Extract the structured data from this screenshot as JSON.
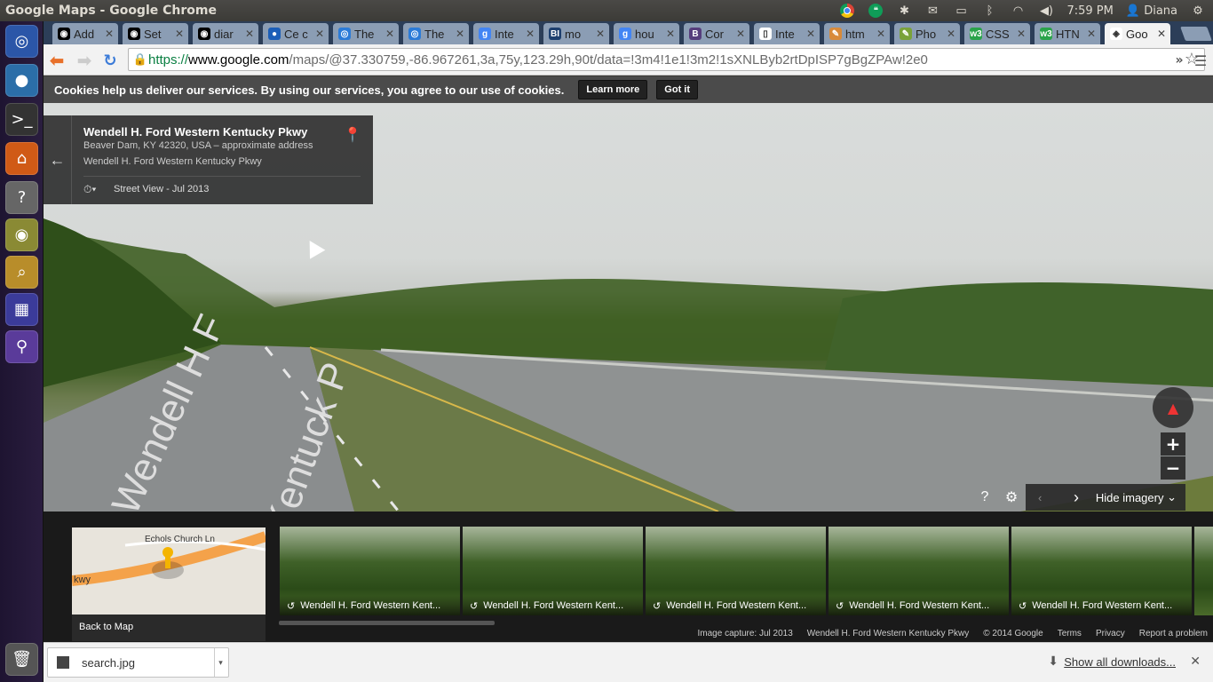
{
  "window_title": "Google Maps - Google Chrome",
  "panel": {
    "time": "7:59 PM",
    "user": "Diana"
  },
  "launcher": {
    "items": [
      {
        "name": "dash-icon",
        "color": "#2b56a8",
        "glyph": "◎"
      },
      {
        "name": "chrome-icon",
        "color": "#2b6ea8",
        "glyph": "●"
      },
      {
        "name": "terminal-icon",
        "color": "#333333",
        "glyph": ">_"
      },
      {
        "name": "files-icon",
        "color": "#d05a16",
        "glyph": "⌂"
      },
      {
        "name": "help-icon",
        "color": "#666666",
        "glyph": "?"
      },
      {
        "name": "speaker-icon",
        "color": "#8a8a34",
        "glyph": "◉"
      },
      {
        "name": "search-tool-icon",
        "color": "#b88d2a",
        "glyph": "⌕"
      },
      {
        "name": "workspace-icon",
        "color": "#3b3b9a",
        "glyph": "▦"
      },
      {
        "name": "usb-icon",
        "color": "#5a3b9a",
        "glyph": "⚲"
      }
    ],
    "trash": "trash-icon"
  },
  "tabs": [
    {
      "label": "Add",
      "fav": "#000000",
      "glyph": "◉"
    },
    {
      "label": "Set",
      "fav": "#000000",
      "glyph": "◉"
    },
    {
      "label": "diar",
      "fav": "#000000",
      "glyph": "◉"
    },
    {
      "label": "Ce c",
      "fav": "#1b5eb8",
      "glyph": "●"
    },
    {
      "label": "The",
      "fav": "#2b7bd8",
      "glyph": "◎"
    },
    {
      "label": "The",
      "fav": "#2b7bd8",
      "glyph": "◎"
    },
    {
      "label": "Inte",
      "fav": "#4285f4",
      "glyph": "g"
    },
    {
      "label": "mo",
      "fav": "#1d3f6e",
      "glyph": "BI"
    },
    {
      "label": "hou",
      "fav": "#4285f4",
      "glyph": "g"
    },
    {
      "label": "Cor",
      "fav": "#563d7c",
      "glyph": "B"
    },
    {
      "label": "Inte",
      "fav": "#ffffff",
      "glyph": "▯"
    },
    {
      "label": "htm",
      "fav": "#d88a3a",
      "glyph": "✎"
    },
    {
      "label": "Pho",
      "fav": "#7aa23a",
      "glyph": "✎"
    },
    {
      "label": "CSS",
      "fav": "#2aa34a",
      "glyph": "w3"
    },
    {
      "label": "HTN",
      "fav": "#2aa34a",
      "glyph": "w3"
    },
    {
      "label": "Goo",
      "fav": "#ffffff",
      "glyph": "◈",
      "active": true
    }
  ],
  "url": {
    "scheme": "https://",
    "domain": "www.google.com",
    "path": "/maps/@37.330759,-86.967261,3a,75y,123.29h,90t/data=!3m4!1e1!3m2!1sXNLByb2rtDpISP7gBgZPAw!2e0"
  },
  "cookie": {
    "message": "Cookies help us deliver our services. By using our services, you agree to our use of cookies.",
    "learn_more": "Learn more",
    "got_it": "Got it"
  },
  "streetview": {
    "title": "Wendell H. Ford Western Kentucky Pkwy",
    "address": "Beaver Dam, KY 42320, USA – approximate address",
    "road": "Wendell H. Ford Western Kentucky Pkwy",
    "date_label": "Street View - Jul 2013",
    "hide_imagery": "Hide imagery",
    "road_text_1": "Wendell H F",
    "road_text_2": "Kentuck P"
  },
  "minimap": {
    "street": "Echols Church Ln",
    "road_fragment": "kwy",
    "back_label": "Back to Map"
  },
  "thumbnails": [
    "Wendell H. Ford Western Kent...",
    "Wendell H. Ford Western Kent...",
    "Wendell H. Ford Western Kent...",
    "Wendell H. Ford Western Kent...",
    "Wendell H. Ford Western Kent..."
  ],
  "credits": {
    "capture": "Image capture: Jul 2013",
    "road": "Wendell H. Ford Western Kentucky Pkwy",
    "copyright": "© 2014 Google",
    "terms": "Terms",
    "privacy": "Privacy",
    "report": "Report a problem"
  },
  "downloads": {
    "file": "search.jpg",
    "show_all": "Show all downloads..."
  }
}
